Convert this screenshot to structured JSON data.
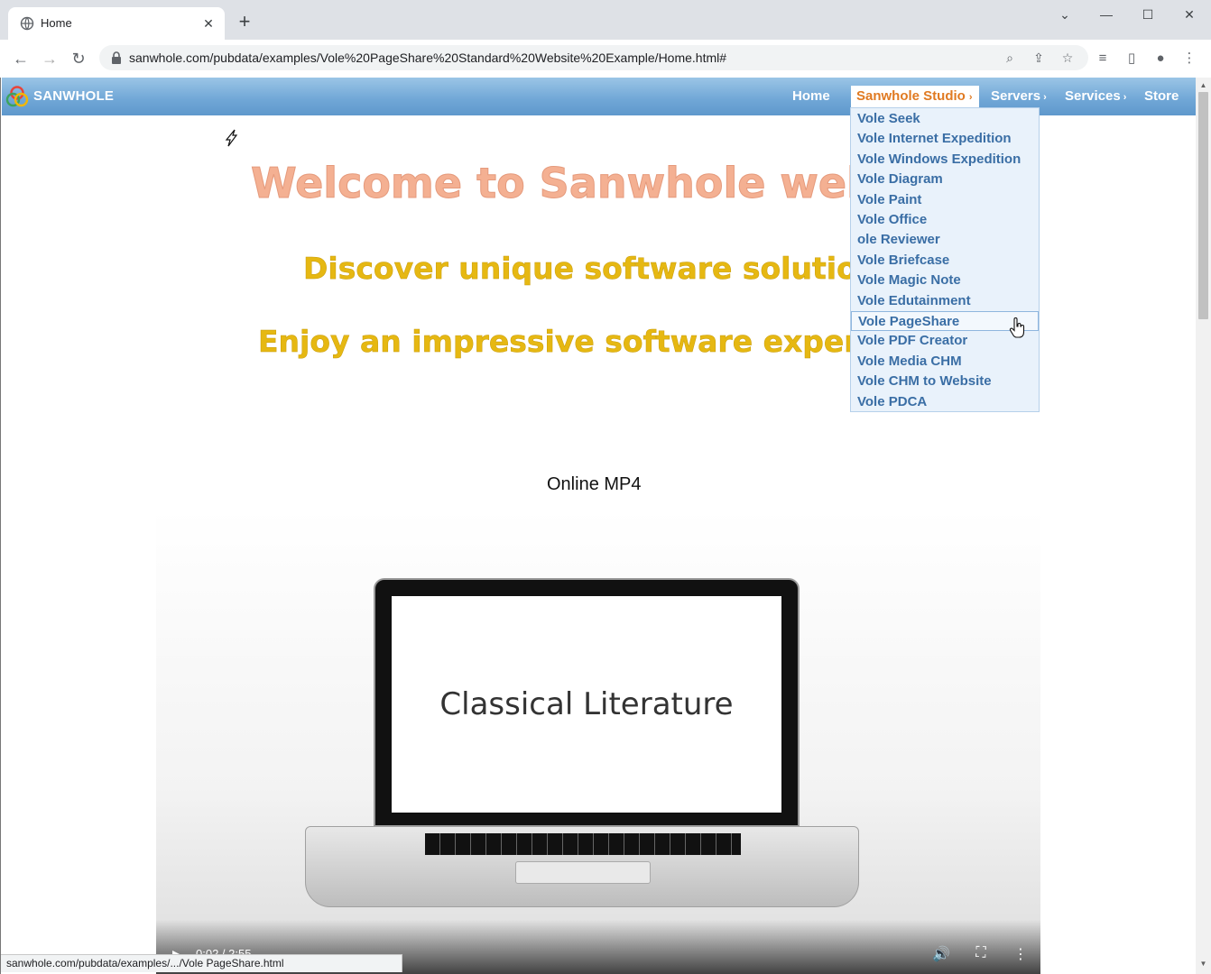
{
  "browser": {
    "tab_title": "Home",
    "tab_close": "✕",
    "new_tab": "+",
    "url": "sanwhole.com/pubdata/examples/Vole%20PageShare%20Standard%20Website%20Example/Home.html#",
    "window_controls": {
      "dropdown": "⌄",
      "minimize": "—",
      "maximize": "☐",
      "close": "✕"
    }
  },
  "site": {
    "brand": "SANWHOLE",
    "nav": {
      "home": "Home",
      "studio": "Sanwhole Studio",
      "servers": "Servers",
      "services": "Services",
      "store": "Store",
      "arrow": "›"
    },
    "dropdown_items": [
      "Vole Seek",
      "Vole Internet Expedition",
      "Vole Windows Expedition",
      "Vole Diagram",
      "Vole Paint",
      "Vole Office",
      "ole Reviewer",
      "Vole Briefcase",
      "Vole Magic Note",
      "Vole Edutainment",
      "Vole PageShare",
      "Vole PDF Creator",
      "Vole Media CHM",
      "Vole CHM to Website",
      "Vole PDCA"
    ],
    "hovered_index": 10,
    "hero": {
      "line1": "Welcome to Sanwhole website",
      "line2": "Discover unique software solutions",
      "line3": "Enjoy an impressive software experience"
    },
    "video": {
      "title": "Online MP4",
      "screen_text": "Classical Literature",
      "time": "0:02 / 2:55",
      "progress": 0.011
    }
  },
  "status_bar": "sanwhole.com/pubdata/examples/.../Vole PageShare.html",
  "colors": {
    "nav_active": "#e07a22",
    "dropdown_text": "#3a6ea5",
    "hero1": "#f4b092",
    "hero2": "#e6b812"
  }
}
